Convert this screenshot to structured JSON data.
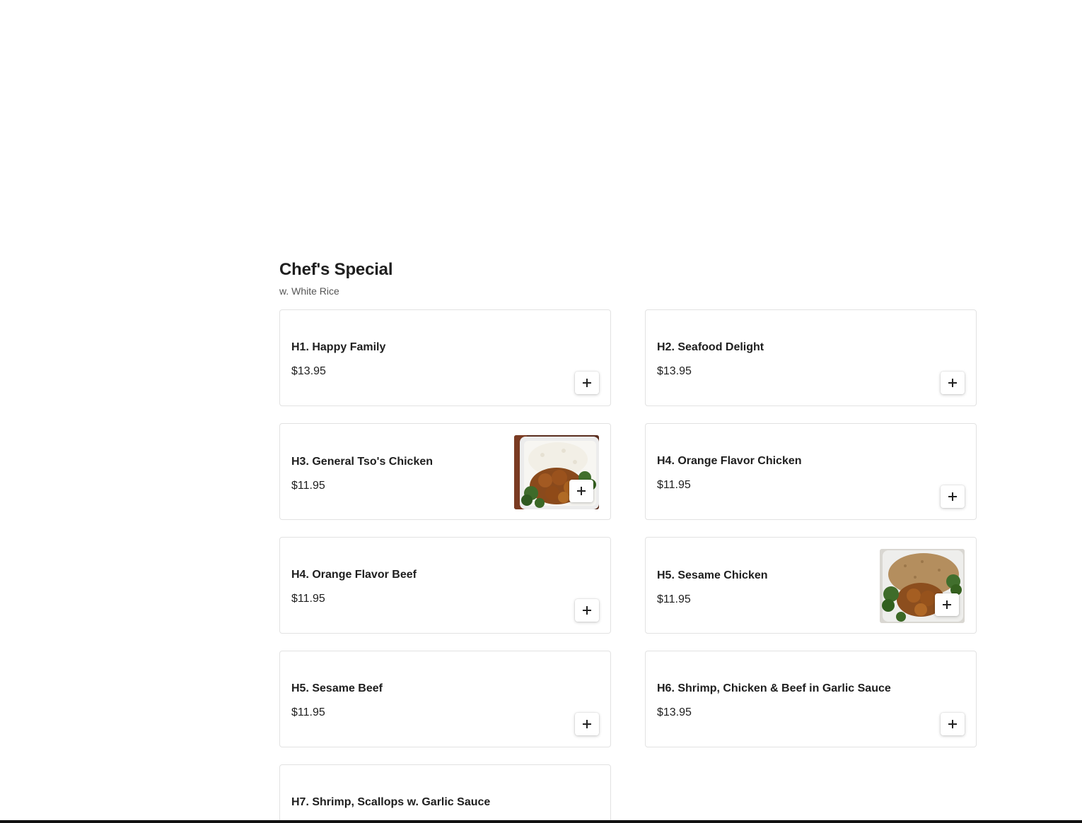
{
  "section": {
    "title": "Chef's Special",
    "subtitle": "w. White Rice"
  },
  "items": [
    {
      "name": "H1. Happy Family",
      "price": "$13.95",
      "has_photo": false
    },
    {
      "name": "H2. Seafood Delight",
      "price": "$13.95",
      "has_photo": false
    },
    {
      "name": "H3. General Tso's Chicken",
      "price": "$11.95",
      "has_photo": true
    },
    {
      "name": "H4. Orange Flavor Chicken",
      "price": "$11.95",
      "has_photo": false
    },
    {
      "name": "H4. Orange Flavor Beef",
      "price": "$11.95",
      "has_photo": false
    },
    {
      "name": "H5. Sesame Chicken",
      "price": "$11.95",
      "has_photo": true
    },
    {
      "name": "H5. Sesame Beef",
      "price": "$11.95",
      "has_photo": false
    },
    {
      "name": "H6. Shrimp, Chicken & Beef in Garlic Sauce",
      "price": "$13.95",
      "has_photo": false
    },
    {
      "name": "H7. Shrimp, Scallops w. Garlic Sauce",
      "price": "",
      "has_photo": false
    }
  ],
  "icons": {
    "add": "plus-icon"
  },
  "colors": {
    "card_border": "#e2e2e2",
    "text": "#1e1e1e",
    "subtitle": "#555555"
  }
}
